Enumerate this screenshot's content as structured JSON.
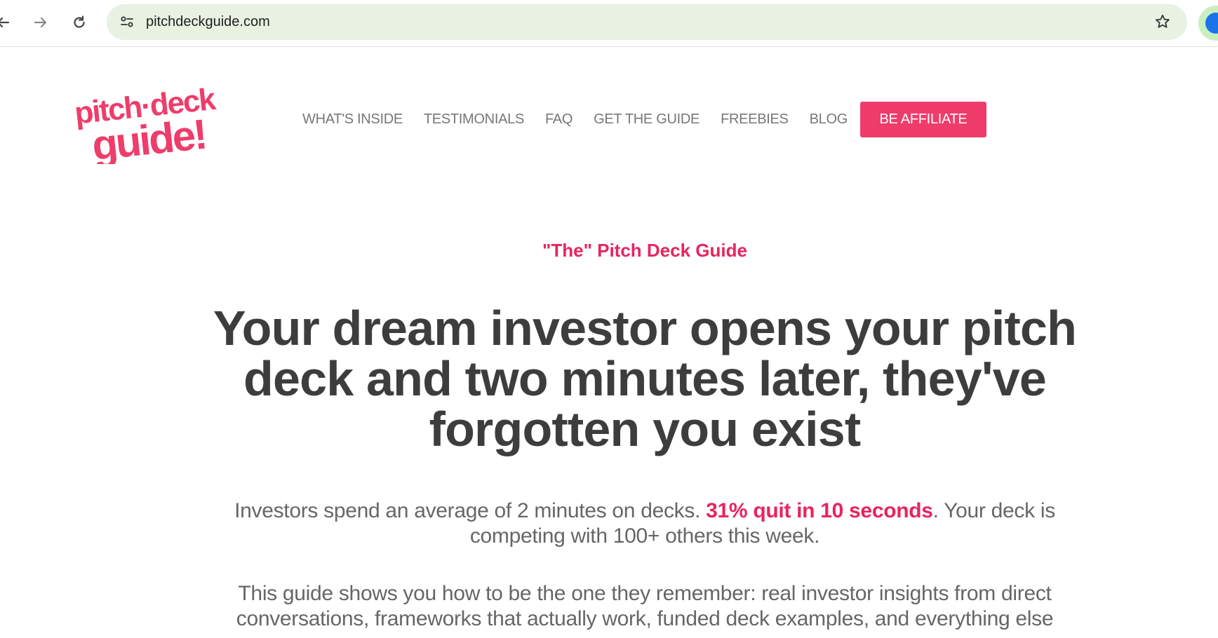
{
  "browser": {
    "url": "pitchdeckguide.com",
    "icons": {
      "back": "back-arrow-icon",
      "forward": "forward-arrow-icon",
      "reload": "reload-icon",
      "site_info": "site-settings-icon",
      "bookmark": "star-icon"
    }
  },
  "site": {
    "logo": {
      "line1": "pitch·deck",
      "line2": "guide!",
      "color": "#ee3d6b"
    },
    "nav": [
      {
        "label": "WHAT'S INSIDE"
      },
      {
        "label": "TESTIMONIALS"
      },
      {
        "label": "FAQ"
      },
      {
        "label": "GET THE GUIDE"
      },
      {
        "label": "FREEBIES"
      },
      {
        "label": "BLOG"
      }
    ],
    "cta": {
      "label": "BE AFFILIATE",
      "color": "#ee3d6b"
    }
  },
  "hero": {
    "eyebrow": "\"The\" Pitch Deck Guide",
    "headline": "Your dream investor opens your pitch deck and two minutes later, they've forgotten you exist",
    "sub1_before": "Investors spend an average of 2 minutes on decks. ",
    "sub1_highlight": "31% quit in 10 seconds",
    "sub1_after": ". Your deck is competing with 100+ others this week.",
    "sub2": "This guide shows you how to be the one they remember: real investor insights from direct conversations, frameworks that actually work, funded deck examples, and everything else"
  },
  "colors": {
    "accent": "#e8245d",
    "button": "#ee3d6b",
    "heading": "#3d3d3d",
    "body_text": "#666666",
    "nav_text": "#777777",
    "omnibox": "#e8f1e2"
  }
}
